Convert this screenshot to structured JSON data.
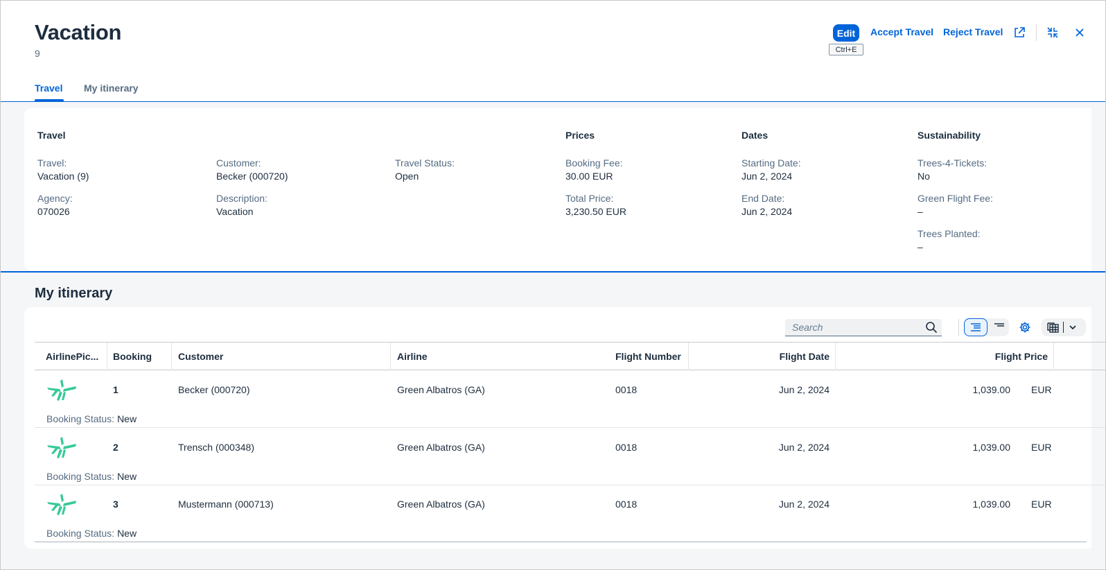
{
  "header": {
    "title": "Vacation",
    "subtitle": "9",
    "edit_label": "Edit",
    "edit_shortcut": "Ctrl+E",
    "accept_label": "Accept Travel",
    "reject_label": "Reject Travel"
  },
  "tabs": [
    {
      "label": "Travel",
      "active": true
    },
    {
      "label": "My itinerary",
      "active": false
    }
  ],
  "travel_group": {
    "title": "Travel",
    "travel_label": "Travel:",
    "travel_value": "Vacation (9)",
    "agency_label": "Agency:",
    "agency_value": "070026",
    "customer_label": "Customer:",
    "customer_value": "Becker (000720)",
    "description_label": "Description:",
    "description_value": "Vacation",
    "status_label": "Travel Status:",
    "status_value": "Open"
  },
  "prices_group": {
    "title": "Prices",
    "booking_fee_label": "Booking Fee:",
    "booking_fee_value": "30.00 EUR",
    "total_label": "Total Price:",
    "total_value": "3,230.50 EUR"
  },
  "dates_group": {
    "title": "Dates",
    "start_label": "Starting Date:",
    "start_value": "Jun 2, 2024",
    "end_label": "End Date:",
    "end_value": "Jun 2, 2024"
  },
  "sustainability_group": {
    "title": "Sustainability",
    "trees_tickets_label": "Trees-4-Tickets:",
    "trees_tickets_value": "No",
    "green_fee_label": "Green Flight Fee:",
    "green_fee_value": "–",
    "trees_planted_label": "Trees Planted:",
    "trees_planted_value": "–"
  },
  "itinerary": {
    "title": "My itinerary",
    "search_placeholder": "Search",
    "columns": [
      "AirlinePic...",
      "Booking",
      "Customer",
      "Airline",
      "Flight Number",
      "Flight Date",
      "Flight Price"
    ],
    "status_label": "Booking Status:",
    "rows": [
      {
        "booking": "1",
        "customer": "Becker (000720)",
        "airline": "Green Albatros (GA)",
        "flight_number": "0018",
        "flight_date": "Jun 2, 2024",
        "price": "1,039.00",
        "currency": "EUR",
        "status": "New"
      },
      {
        "booking": "2",
        "customer": "Trensch (000348)",
        "airline": "Green Albatros (GA)",
        "flight_number": "0018",
        "flight_date": "Jun 2, 2024",
        "price": "1,039.00",
        "currency": "EUR",
        "status": "New"
      },
      {
        "booking": "3",
        "customer": "Mustermann (000713)",
        "airline": "Green Albatros (GA)",
        "flight_number": "0018",
        "flight_date": "Jun 2, 2024",
        "price": "1,039.00",
        "currency": "EUR",
        "status": "New"
      }
    ]
  },
  "colors": {
    "accent": "#0064d9",
    "text": "#1d2d3e",
    "label": "#556b82",
    "airline_logo": "#36c99a"
  }
}
